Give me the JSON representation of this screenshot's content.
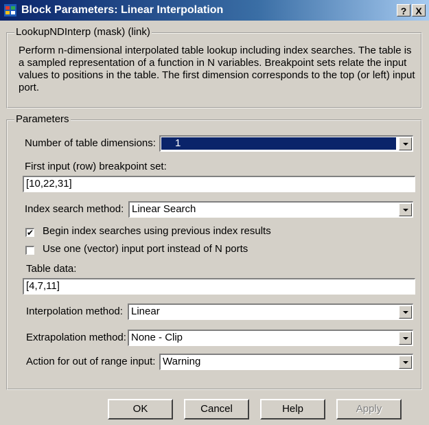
{
  "window": {
    "title": "Block Parameters: Linear Interpolation",
    "help_glyph": "?",
    "close_glyph": "X"
  },
  "description_group": {
    "legend": "LookupNDInterp (mask) (link)",
    "text": "Perform n-dimensional interpolated table lookup including index searches.  The table is a sampled representation of a function in N variables.  Breakpoint sets relate the input values to positions in the table.  The first dimension corresponds to the top (or left) input port."
  },
  "parameters": {
    "legend": "Parameters",
    "num_dims_label": "Number of table dimensions:",
    "num_dims_value": "1",
    "first_input_label": "First input (row) breakpoint set:",
    "first_input_value": "[10,22,31]",
    "index_search_label": "Index search method:",
    "index_search_value": "Linear Search",
    "begin_index_label": "Begin index searches using previous index results",
    "begin_index_checked": true,
    "use_one_port_label": "Use one (vector) input port instead of N ports",
    "use_one_port_checked": false,
    "table_data_label": "Table data:",
    "table_data_value": "[4,7,11]",
    "interp_label": "Interpolation method:",
    "interp_value": "Linear",
    "extrap_label": "Extrapolation method:",
    "extrap_value": "None - Clip",
    "action_label": "Action for out of range input:",
    "action_value": "Warning"
  },
  "buttons": {
    "ok": "OK",
    "cancel": "Cancel",
    "help": "Help",
    "apply": "Apply"
  },
  "colors": {
    "titlebar_start": "#0a246a",
    "titlebar_end": "#a6caf0",
    "dialog_bg": "#d4d0c8",
    "selection": "#0a246a"
  }
}
